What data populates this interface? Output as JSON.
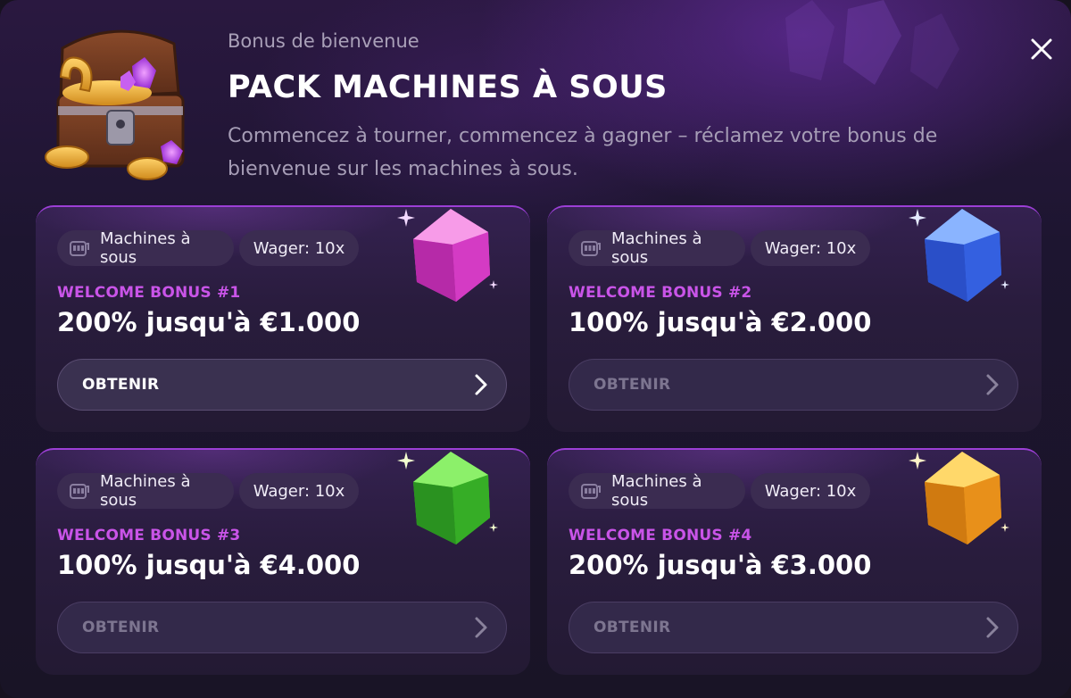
{
  "header": {
    "subtitle": "Bonus de bienvenue",
    "title": "PACK MACHINES À SOUS",
    "description": "Commencez à tourner, commencez à gagner – réclamez votre bonus de bienvenue sur les machines à sous."
  },
  "cards": [
    {
      "category": "Machines à sous",
      "wager": "Wager: 10x",
      "label": "WELCOME BONUS #1",
      "amount": "200% jusqu'à €1.000",
      "button": "OBTENIR",
      "gem": "pink-gem-icon"
    },
    {
      "category": "Machines à sous",
      "wager": "Wager: 10x",
      "label": "WELCOME BONUS #2",
      "amount": "100% jusqu'à €2.000",
      "button": "OBTENIR",
      "gem": "blue-gem-icon"
    },
    {
      "category": "Machines à sous",
      "wager": "Wager: 10x",
      "label": "WELCOME BONUS #3",
      "amount": "100% jusqu'à €4.000",
      "button": "OBTENIR",
      "gem": "green-gem-icon"
    },
    {
      "category": "Machines à sous",
      "wager": "Wager: 10x",
      "label": "WELCOME BONUS #4",
      "amount": "200% jusqu'à €3.000",
      "button": "OBTENIR",
      "gem": "orange-gem-icon"
    }
  ],
  "colors": {
    "accent": "#c954e8",
    "background": "#1d1530",
    "card": "#291c3d"
  }
}
